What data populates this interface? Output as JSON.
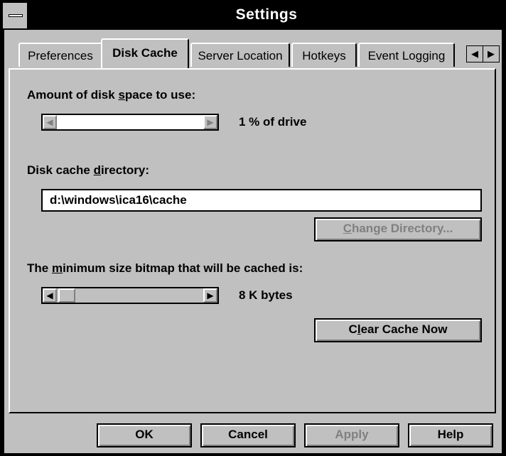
{
  "window": {
    "title": "Settings"
  },
  "tabs": {
    "items": [
      {
        "label": "Preferences"
      },
      {
        "label": "Disk Cache"
      },
      {
        "label": "Server Location"
      },
      {
        "label": "Hotkeys"
      },
      {
        "label": "Event Logging"
      }
    ],
    "active": "Disk Cache",
    "scroll_left_icon": "left-triangle",
    "scroll_right_icon": "right-triangle"
  },
  "disk_space": {
    "label_pre": "Amount of disk ",
    "label_accel": "s",
    "label_post": "pace to use:",
    "value_text": "1 % of drive",
    "slider_value_percent": 1
  },
  "cache_dir": {
    "label_pre": "Disk cache ",
    "label_accel": "d",
    "label_post": "irectory:",
    "value": "d:\\windows\\ica16\\cache",
    "change_button_accel": "C",
    "change_button_rest": "hange Directory...",
    "change_button_enabled": false
  },
  "min_bitmap": {
    "label_pre": "The ",
    "label_accel": "m",
    "label_post": "inimum size bitmap that will be cached is:",
    "value_text": "8 K bytes",
    "clear_button_pre": "C",
    "clear_button_accel": "l",
    "clear_button_post": "ear Cache Now"
  },
  "buttons": {
    "ok": "OK",
    "cancel": "Cancel",
    "apply": "Apply",
    "help": "Help"
  }
}
